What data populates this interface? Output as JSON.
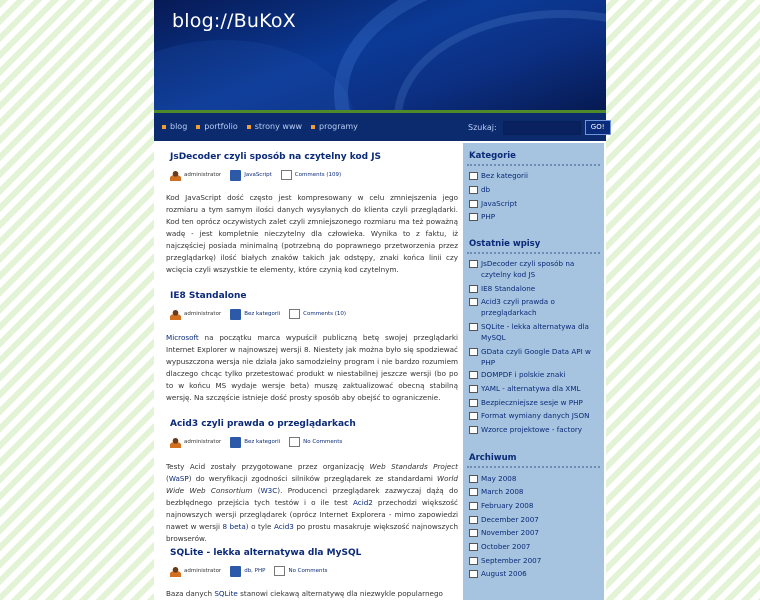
{
  "site": {
    "title": "blog://BuKoX"
  },
  "nav": {
    "items": [
      "blog",
      "portfolio",
      "strony www",
      "programy"
    ],
    "search_label": "Szukaj:",
    "search_value": "",
    "search_button": "GO!"
  },
  "posts": [
    {
      "title": "JsDecoder czyli sposób na czytelny kod JS",
      "author": "administrator",
      "category": "JavaScript",
      "comments": "Comments (109)",
      "body": "Kod JavaScript dość często jest kompresowany w celu zmniejszenia jego rozmiaru a tym samym ilości danych wysyłanych do klienta czyli przeglądarki. Kod ten oprócz oczywistych zalet czyli zmniejszonego rozmiaru ma też poważną wadę - jest kompletnie nieczytelny dla człowieka. Wynika to z faktu, iż najczęściej posiada minimalną (potrzebną do poprawnego przetworzenia przez przeglądarkę) ilość białych znaków takich jak odstępy, znaki końca linii czy wcięcia czyli wszystkie te elementy, które czynią kod czytelnym."
    },
    {
      "title": "IE8 Standalone",
      "author": "administrator",
      "category": "Bez kategorii",
      "comments": "Comments (10)",
      "body_link": "Microsoft",
      "body": " na początku marca wypuścił publiczną betę swojej przeglądarki Internet Explorer w najnowszej wersji 8. Niestety jak można było się spodziewać wypuszczona wersja nie działa jako samodzielny program i nie bardzo rozumiem dlaczego chcąc tylko przetestować produkt w niestabilnej jeszcze wersji (bo po to w końcu MS wydaje wersje beta) muszę zaktualizować obecną stabilną wersję. Na szczęście istnieje dość prosty sposób aby obejść to ograniczenie."
    },
    {
      "title": "Acid3 czyli prawda o przeglądarkach",
      "author": "administrator",
      "category": "Bez kategorii",
      "comments": "No Comments",
      "body_parts": {
        "p1": "Testy Acid zostały przygotowane przez organizację ",
        "wsp": "Web Standards Project",
        "p2": " (",
        "wasp": "WaSP",
        "p3": ") do weryfikacji zgodności silników przeglądarek ze standardami ",
        "w3": "World Wide Web Consortium",
        "p4": " (",
        "w3c": "W3C",
        "p5": "). Producenci przeglądarek zazwyczaj dążą do bezbłędnego przejścia tych testów i o ile test ",
        "acid2": "Acid2",
        "p6": " przechodzi większość najnowszych wersji przeglądarek (oprócz Internet Explorera - mimo zapowiedzi nawet w wersji ",
        "beta": "8 beta",
        "p7": ") o tyle ",
        "acid3": "Acid3",
        "p8": " po prostu masakruje większość najnowszych browserów."
      }
    },
    {
      "title": "SQLite - lekka alternatywa dla MySQL",
      "author": "administrator",
      "category": "db, PHP",
      "comments": "No Comments",
      "body_p1": "Baza danych ",
      "body_link": "SQLite",
      "body_p2": " stanowi ciekawą alternatywę dla niezwykle popularnego"
    }
  ],
  "sidebar": {
    "categories_title": "Kategorie",
    "categories": [
      "Bez kategorii",
      "db",
      "JavaScript",
      "PHP"
    ],
    "recent_title": "Ostatnie wpisy",
    "recent": [
      "JsDecoder czyli sposób na czytelny kod JS",
      "IE8 Standalone",
      "Acid3 czyli prawda o przeglądarkach",
      "SQLite - lekka alternatywa dla MySQL",
      "GData czyli Google Data API w PHP",
      "DOMPDF i polskie znaki",
      "YAML - alternatywa dla XML",
      "Bezpieczniejsze sesje w PHP",
      "Format wymiany danych JSON",
      "Wzorce projektowe - factory"
    ],
    "archive_title": "Archiwum",
    "archive": [
      "May 2008",
      "March 2008",
      "February 2008",
      "December 2007",
      "November 2007",
      "October 2007",
      "September 2007",
      "August 2006"
    ]
  }
}
